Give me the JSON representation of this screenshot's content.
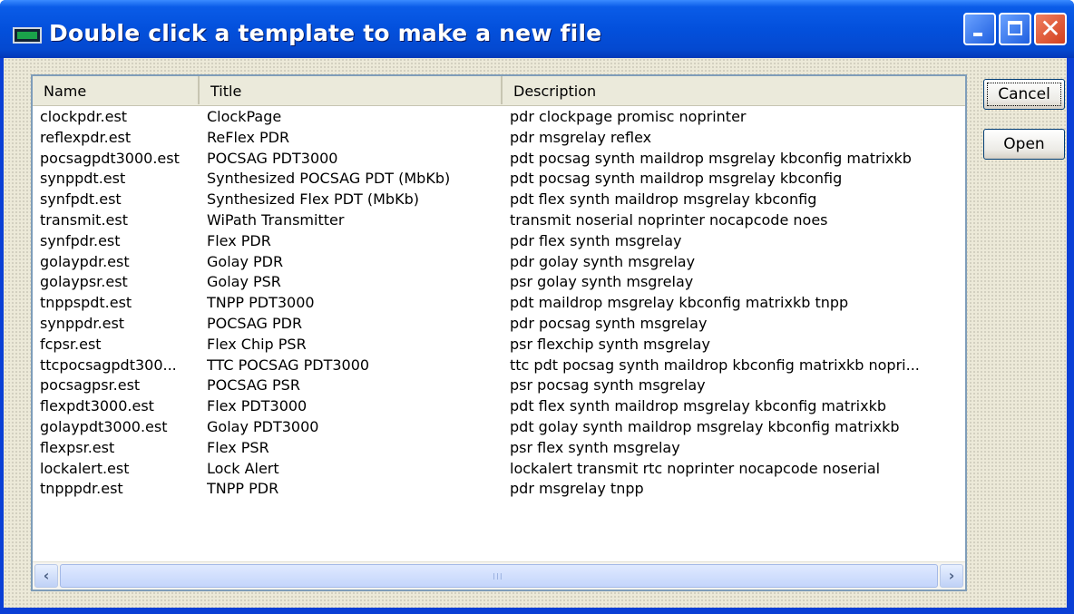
{
  "window": {
    "title": "Double click a template to make a new file",
    "close_glyph": "✕",
    "icons": [
      "app-icon",
      "minimize-icon",
      "maximize-icon",
      "close-icon"
    ]
  },
  "list": {
    "columns": [
      "Name",
      "Title",
      "Description"
    ],
    "rows": [
      {
        "name": "clockpdr.est",
        "title": "ClockPage",
        "description": "pdr clockpage promisc noprinter"
      },
      {
        "name": "reflexpdr.est",
        "title": "ReFlex PDR",
        "description": "pdr msgrelay reflex"
      },
      {
        "name": "pocsagpdt3000.est",
        "title": "POCSAG PDT3000",
        "description": "pdt pocsag synth maildrop msgrelay kbconfig matrixkb"
      },
      {
        "name": "synppdt.est",
        "title": "Synthesized POCSAG PDT (MbKb)",
        "description": "pdt pocsag synth maildrop msgrelay kbconfig"
      },
      {
        "name": "synfpdt.est",
        "title": "Synthesized Flex PDT (MbKb)",
        "description": "pdt flex synth maildrop msgrelay kbconfig"
      },
      {
        "name": "transmit.est",
        "title": "WiPath Transmitter",
        "description": "transmit noserial noprinter nocapcode noes"
      },
      {
        "name": "synfpdr.est",
        "title": "Flex PDR",
        "description": "pdr flex synth msgrelay"
      },
      {
        "name": "golaypdr.est",
        "title": "Golay PDR",
        "description": "pdr golay synth msgrelay"
      },
      {
        "name": "golaypsr.est",
        "title": "Golay PSR",
        "description": "psr golay synth msgrelay"
      },
      {
        "name": "tnppspdt.est",
        "title": "TNPP PDT3000",
        "description": "pdt maildrop msgrelay kbconfig matrixkb tnpp"
      },
      {
        "name": "synppdr.est",
        "title": "POCSAG PDR",
        "description": "pdr pocsag synth msgrelay"
      },
      {
        "name": "fcpsr.est",
        "title": "Flex Chip PSR",
        "description": "psr flexchip synth msgrelay"
      },
      {
        "name": "ttcpocsagpdt300...",
        "title": "TTC POCSAG PDT3000",
        "description": "ttc pdt pocsag synth maildrop kbconfig matrixkb nopri..."
      },
      {
        "name": "pocsagpsr.est",
        "title": "POCSAG PSR",
        "description": "psr pocsag synth msgrelay"
      },
      {
        "name": "flexpdt3000.est",
        "title": "Flex PDT3000",
        "description": "pdt flex synth maildrop msgrelay kbconfig matrixkb"
      },
      {
        "name": "golaypdt3000.est",
        "title": "Golay PDT3000",
        "description": "pdt golay synth maildrop msgrelay kbconfig matrixkb"
      },
      {
        "name": "flexpsr.est",
        "title": "Flex PSR",
        "description": "psr flex synth msgrelay"
      },
      {
        "name": "lockalert.est",
        "title": "Lock Alert",
        "description": "lockalert transmit rtc noprinter nocapcode noserial"
      },
      {
        "name": "tnpppdr.est",
        "title": "TNPP PDR",
        "description": "pdr msgrelay tnpp"
      }
    ]
  },
  "scrollbar": {
    "left_glyph": "‹",
    "right_glyph": "›",
    "grip": "III"
  },
  "buttons": {
    "cancel": "Cancel",
    "open": "Open"
  }
}
